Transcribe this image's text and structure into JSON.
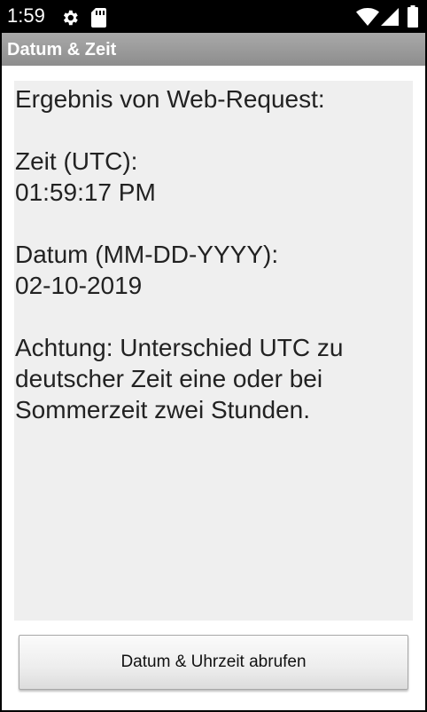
{
  "status_bar": {
    "time": "1:59",
    "icons": [
      "settings-gear-icon",
      "sd-card-icon",
      "wifi-icon",
      "cellular-signal-icon",
      "battery-icon"
    ]
  },
  "app": {
    "title": "Datum & Zeit"
  },
  "result": {
    "text": "Ergebnis von Web-Request:\n\nZeit (UTC):\n01:59:17 PM\n\nDatum (MM-DD-YYYY):\n02-10-2019\n\nAchtung: Unterschied UTC zu deutscher Zeit eine oder bei Sommerzeit zwei Stunden."
  },
  "actions": {
    "fetch_label": "Datum & Uhrzeit abrufen"
  },
  "colors": {
    "title_bar": "#989898",
    "panel_background": "#efefef",
    "status_bar": "#000000"
  }
}
